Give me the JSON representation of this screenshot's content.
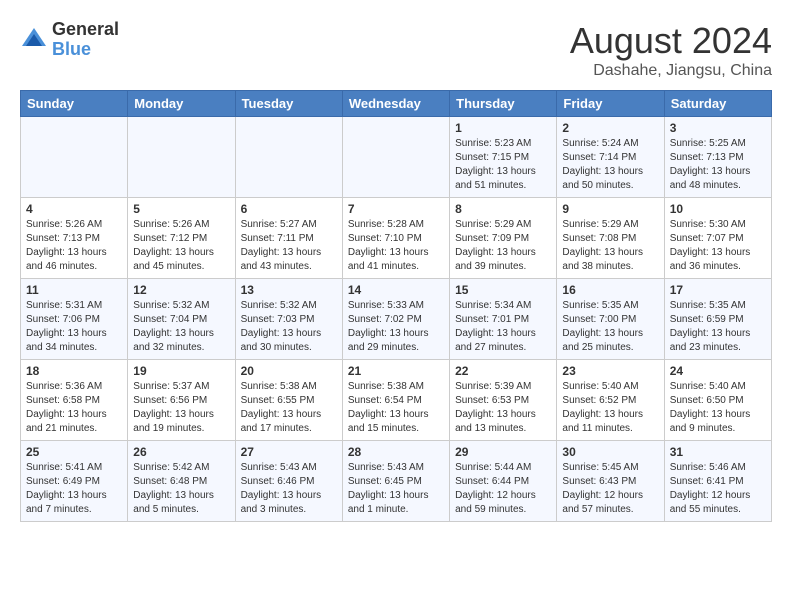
{
  "logo": {
    "general": "General",
    "blue": "Blue"
  },
  "header": {
    "month_year": "August 2024",
    "location": "Dashahe, Jiangsu, China"
  },
  "days_of_week": [
    "Sunday",
    "Monday",
    "Tuesday",
    "Wednesday",
    "Thursday",
    "Friday",
    "Saturday"
  ],
  "weeks": [
    [
      {
        "day": "",
        "info": ""
      },
      {
        "day": "",
        "info": ""
      },
      {
        "day": "",
        "info": ""
      },
      {
        "day": "",
        "info": ""
      },
      {
        "day": "1",
        "info": "Sunrise: 5:23 AM\nSunset: 7:15 PM\nDaylight: 13 hours\nand 51 minutes."
      },
      {
        "day": "2",
        "info": "Sunrise: 5:24 AM\nSunset: 7:14 PM\nDaylight: 13 hours\nand 50 minutes."
      },
      {
        "day": "3",
        "info": "Sunrise: 5:25 AM\nSunset: 7:13 PM\nDaylight: 13 hours\nand 48 minutes."
      }
    ],
    [
      {
        "day": "4",
        "info": "Sunrise: 5:26 AM\nSunset: 7:13 PM\nDaylight: 13 hours\nand 46 minutes."
      },
      {
        "day": "5",
        "info": "Sunrise: 5:26 AM\nSunset: 7:12 PM\nDaylight: 13 hours\nand 45 minutes."
      },
      {
        "day": "6",
        "info": "Sunrise: 5:27 AM\nSunset: 7:11 PM\nDaylight: 13 hours\nand 43 minutes."
      },
      {
        "day": "7",
        "info": "Sunrise: 5:28 AM\nSunset: 7:10 PM\nDaylight: 13 hours\nand 41 minutes."
      },
      {
        "day": "8",
        "info": "Sunrise: 5:29 AM\nSunset: 7:09 PM\nDaylight: 13 hours\nand 39 minutes."
      },
      {
        "day": "9",
        "info": "Sunrise: 5:29 AM\nSunset: 7:08 PM\nDaylight: 13 hours\nand 38 minutes."
      },
      {
        "day": "10",
        "info": "Sunrise: 5:30 AM\nSunset: 7:07 PM\nDaylight: 13 hours\nand 36 minutes."
      }
    ],
    [
      {
        "day": "11",
        "info": "Sunrise: 5:31 AM\nSunset: 7:06 PM\nDaylight: 13 hours\nand 34 minutes."
      },
      {
        "day": "12",
        "info": "Sunrise: 5:32 AM\nSunset: 7:04 PM\nDaylight: 13 hours\nand 32 minutes."
      },
      {
        "day": "13",
        "info": "Sunrise: 5:32 AM\nSunset: 7:03 PM\nDaylight: 13 hours\nand 30 minutes."
      },
      {
        "day": "14",
        "info": "Sunrise: 5:33 AM\nSunset: 7:02 PM\nDaylight: 13 hours\nand 29 minutes."
      },
      {
        "day": "15",
        "info": "Sunrise: 5:34 AM\nSunset: 7:01 PM\nDaylight: 13 hours\nand 27 minutes."
      },
      {
        "day": "16",
        "info": "Sunrise: 5:35 AM\nSunset: 7:00 PM\nDaylight: 13 hours\nand 25 minutes."
      },
      {
        "day": "17",
        "info": "Sunrise: 5:35 AM\nSunset: 6:59 PM\nDaylight: 13 hours\nand 23 minutes."
      }
    ],
    [
      {
        "day": "18",
        "info": "Sunrise: 5:36 AM\nSunset: 6:58 PM\nDaylight: 13 hours\nand 21 minutes."
      },
      {
        "day": "19",
        "info": "Sunrise: 5:37 AM\nSunset: 6:56 PM\nDaylight: 13 hours\nand 19 minutes."
      },
      {
        "day": "20",
        "info": "Sunrise: 5:38 AM\nSunset: 6:55 PM\nDaylight: 13 hours\nand 17 minutes."
      },
      {
        "day": "21",
        "info": "Sunrise: 5:38 AM\nSunset: 6:54 PM\nDaylight: 13 hours\nand 15 minutes."
      },
      {
        "day": "22",
        "info": "Sunrise: 5:39 AM\nSunset: 6:53 PM\nDaylight: 13 hours\nand 13 minutes."
      },
      {
        "day": "23",
        "info": "Sunrise: 5:40 AM\nSunset: 6:52 PM\nDaylight: 13 hours\nand 11 minutes."
      },
      {
        "day": "24",
        "info": "Sunrise: 5:40 AM\nSunset: 6:50 PM\nDaylight: 13 hours\nand 9 minutes."
      }
    ],
    [
      {
        "day": "25",
        "info": "Sunrise: 5:41 AM\nSunset: 6:49 PM\nDaylight: 13 hours\nand 7 minutes."
      },
      {
        "day": "26",
        "info": "Sunrise: 5:42 AM\nSunset: 6:48 PM\nDaylight: 13 hours\nand 5 minutes."
      },
      {
        "day": "27",
        "info": "Sunrise: 5:43 AM\nSunset: 6:46 PM\nDaylight: 13 hours\nand 3 minutes."
      },
      {
        "day": "28",
        "info": "Sunrise: 5:43 AM\nSunset: 6:45 PM\nDaylight: 13 hours\nand 1 minute."
      },
      {
        "day": "29",
        "info": "Sunrise: 5:44 AM\nSunset: 6:44 PM\nDaylight: 12 hours\nand 59 minutes."
      },
      {
        "day": "30",
        "info": "Sunrise: 5:45 AM\nSunset: 6:43 PM\nDaylight: 12 hours\nand 57 minutes."
      },
      {
        "day": "31",
        "info": "Sunrise: 5:46 AM\nSunset: 6:41 PM\nDaylight: 12 hours\nand 55 minutes."
      }
    ]
  ]
}
